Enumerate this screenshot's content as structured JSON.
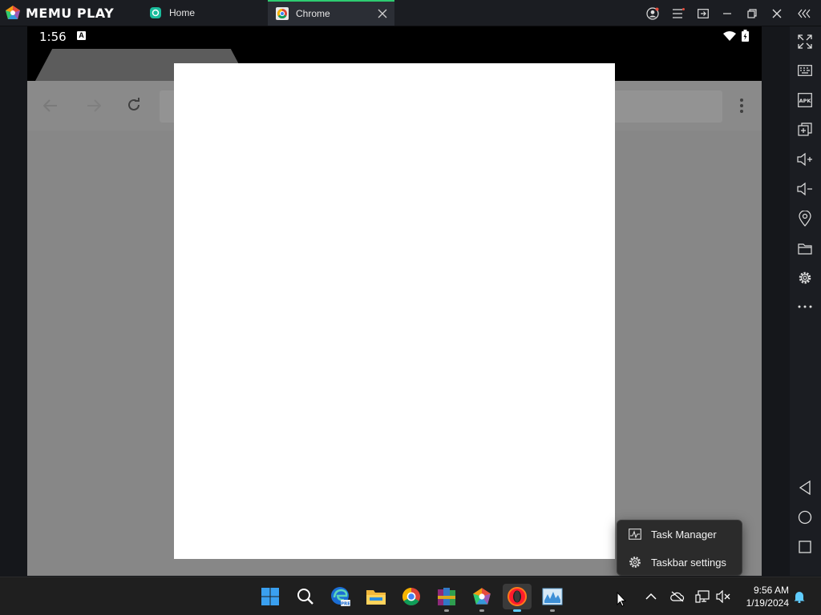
{
  "app": {
    "name": "MEMU PLAY"
  },
  "tabs": [
    {
      "label": "Home",
      "icon": "memu-home-icon"
    },
    {
      "label": "Chrome",
      "icon": "chrome-icon",
      "active": true
    }
  ],
  "window_controls": [
    "account-icon",
    "menu-icon",
    "multi-window-icon",
    "minimize-icon",
    "restore-icon",
    "close-icon",
    "collapse-sidebar-icon"
  ],
  "android": {
    "status_time": "1:56",
    "status_badge": "A",
    "status_icons": [
      "wifi-icon",
      "battery-icon"
    ]
  },
  "sidebar_tools": [
    "fullscreen-icon",
    "keyboard-icon",
    "apk-icon",
    "add-window-icon",
    "volume-up-icon",
    "volume-down-icon",
    "location-icon",
    "folder-icon",
    "settings-icon",
    "more-icon",
    "back-icon",
    "home-icon",
    "recents-icon"
  ],
  "context_menu": {
    "items": [
      {
        "label": "Task Manager",
        "icon": "task-manager-icon"
      },
      {
        "label": "Taskbar settings",
        "icon": "settings-icon"
      }
    ]
  },
  "taskbar": {
    "apps": [
      "windows-start-icon",
      "search-icon",
      "edge-icon",
      "file-explorer-icon",
      "chrome-icon",
      "winrar-icon",
      "memu-icon",
      "opera-icon",
      "task-manager-app-icon"
    ],
    "tray_icons": [
      "chevron-up-icon",
      "onedrive-icon",
      "network-icon",
      "speaker-muted-icon"
    ],
    "time": "9:56 AM",
    "date": "1/19/2024",
    "notification_icon": "bell-icon"
  },
  "colors": {
    "accent": "#60cdff",
    "tab_active_indicator": "#2ecc71",
    "dialog_bg": "#ffffff"
  }
}
